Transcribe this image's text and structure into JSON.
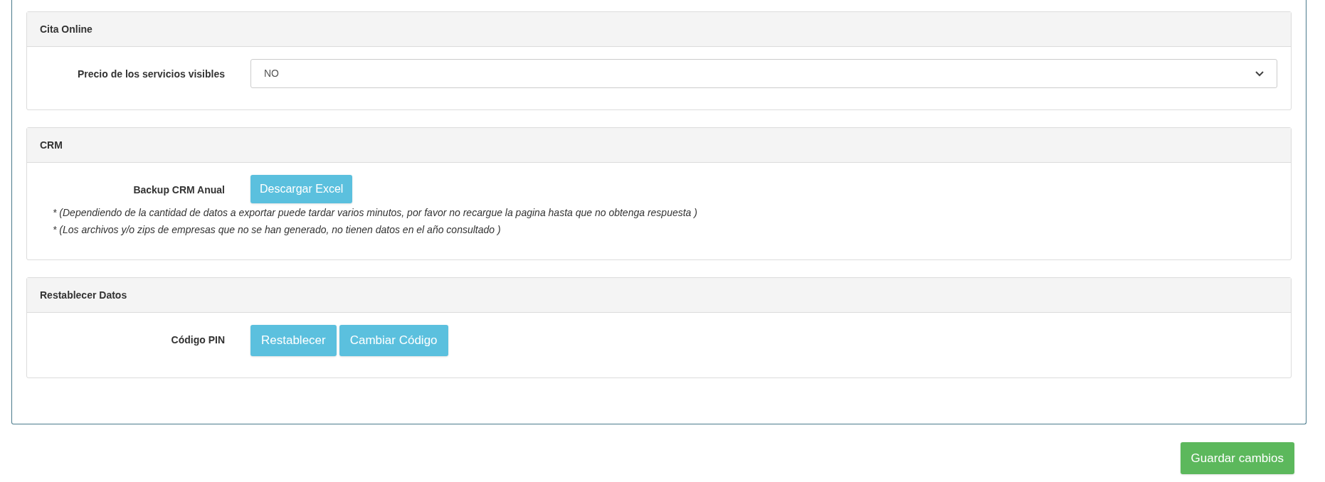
{
  "panels": [
    {
      "title": "Cita Online",
      "rows": [
        {
          "kind": "select",
          "label": "Precio de los servicios visibles",
          "value": "NO"
        }
      ]
    },
    {
      "title": "CRM",
      "rows": [
        {
          "kind": "buttons",
          "label": "Backup CRM Anual",
          "buttons": [
            "Descargar Excel"
          ],
          "notes": [
            "* (Dependiendo de la cantidad de datos a exportar puede tardar varios minutos, por favor no recargue la pagina hasta que no obtenga respuesta )",
            "* (Los archivos y/o zips de empresas que no se han generado, no tienen datos en el año consultado )"
          ]
        }
      ]
    },
    {
      "title": "Restablecer Datos",
      "rows": [
        {
          "kind": "buttons",
          "label": "Código PIN",
          "buttons": [
            "Restablecer",
            "Cambiar Código"
          ],
          "big": true
        }
      ]
    }
  ],
  "save_button": "Guardar cambios"
}
